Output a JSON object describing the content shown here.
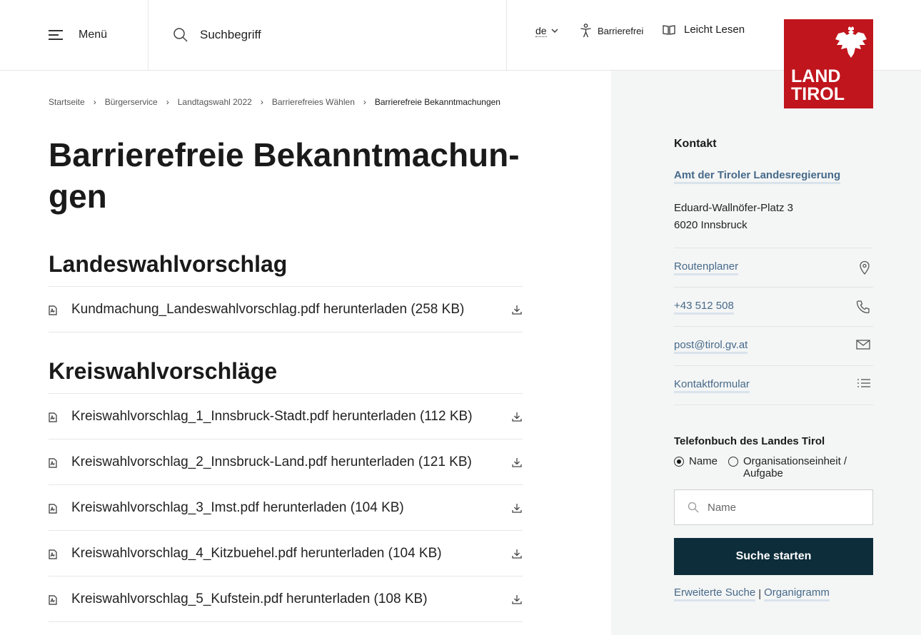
{
  "header": {
    "menu_label": "Menü",
    "search_placeholder": "Suchbegriff",
    "language": "de",
    "accessibility_label": "Barrierefrei",
    "easy_read_label": "Leicht Lesen",
    "logo_line1": "LAND",
    "logo_line2": "TIROL"
  },
  "breadcrumb": {
    "items": [
      "Startseite",
      "Bürgerservice",
      "Landtagswahl 2022",
      "Barrierefreies Wählen"
    ],
    "current": "Barrierefreie Bekanntmachungen"
  },
  "page_title_line1": "Barrierefreie Bekanntmachun-",
  "page_title_line2": "gen",
  "sections": [
    {
      "heading": "Landeswahlvorschlag",
      "files": [
        "Kundmachung_Landeswahlvorschlag.pdf herunterladen (258 KB)"
      ]
    },
    {
      "heading": "Kreiswahlvorschläge",
      "files": [
        "Kreiswahlvorschlag_1_Innsbruck-Stadt.pdf herunterladen (112 KB)",
        "Kreiswahlvorschlag_2_Innsbruck-Land.pdf herunterladen (121 KB)",
        "Kreiswahlvorschlag_3_Imst.pdf herunterladen (104 KB)",
        "Kreiswahlvorschlag_4_Kitzbuehel.pdf herunterladen (104 KB)",
        "Kreiswahlvorschlag_5_Kufstein.pdf herunterladen (108 KB)"
      ]
    }
  ],
  "sidebar": {
    "title": "Kontakt",
    "organization": "Amt der Tiroler Landesregierung",
    "address_line1": "Eduard-Wallnöfer-Platz 3",
    "address_line2": "6020 Innsbruck",
    "contacts": [
      {
        "label": "Routenplaner",
        "icon": "location-pin-icon"
      },
      {
        "label": "+43 512 508",
        "icon": "phone-icon"
      },
      {
        "label": "post@tirol.gv.at",
        "icon": "mail-icon"
      },
      {
        "label": "Kontaktformular",
        "icon": "list-icon"
      }
    ],
    "phonebook_title": "Telefonbuch des Landes Tirol",
    "radio_name": "Name",
    "radio_org_line1": "Organisationseinheit /",
    "radio_org_line2": "Aufgabe",
    "name_placeholder": "Name",
    "search_button": "Suche starten",
    "advanced_search": "Erweiterte Suche",
    "separator": "|",
    "org_chart": "Organigramm"
  },
  "colors": {
    "logo_red": "#c0151d",
    "button_dark": "#0d2d3a",
    "link_blue": "#466a8a",
    "sidebar_bg": "#f4f5f5"
  }
}
